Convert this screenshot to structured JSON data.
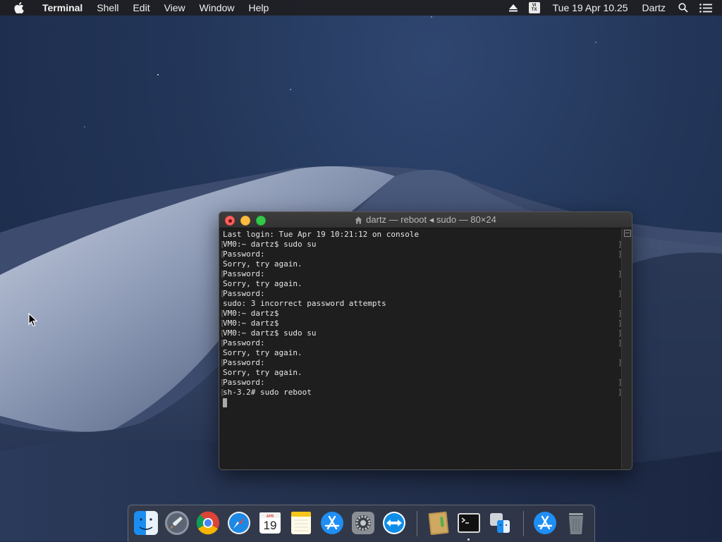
{
  "menubar": {
    "app_name": "Terminal",
    "menus": [
      "Shell",
      "Edit",
      "View",
      "Window",
      "Help"
    ],
    "ime_label_top": "VI",
    "ime_label_bottom": "TX",
    "datetime": "Tue 19 Apr  10.25",
    "user": "Dartz"
  },
  "terminal": {
    "title": "dartz — reboot ◂ sudo — 80×24",
    "lines": [
      "Last login: Tue Apr 19 10:21:12 on console",
      "VM0:~ dartz$ sudo su",
      "Password:",
      "Sorry, try again.",
      "Password:",
      "Sorry, try again.",
      "Password:",
      "sudo: 3 incorrect password attempts",
      "VM0:~ dartz$",
      "VM0:~ dartz$",
      "VM0:~ dartz$ sudo su",
      "Password:",
      "Sorry, try again.",
      "Password:",
      "Sorry, try again.",
      "Password:",
      "sh-3.2# sudo reboot"
    ]
  },
  "dock": {
    "calendar_month": "APR",
    "calendar_day": "19",
    "items": [
      "finder-icon",
      "launchpad-icon",
      "chrome-icon",
      "safari-icon",
      "calendar-icon",
      "notes-icon",
      "app-store-icon",
      "system-preferences-icon",
      "teamviewer-icon",
      "archive-icon",
      "terminal-icon",
      "migration-assistant-icon",
      "app-store-downloads-icon",
      "trash-icon"
    ]
  },
  "colors": {
    "menubar_bg": "#1e1e22",
    "terminal_bg": "#1e1e1e",
    "terminal_text": "#e6e6e6",
    "close": "#fc605c",
    "minimize": "#fdbc40",
    "maximize": "#34c84a"
  }
}
